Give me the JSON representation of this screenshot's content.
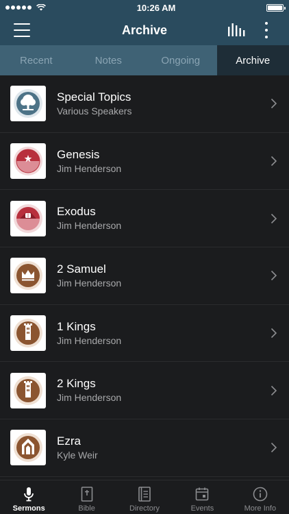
{
  "status_bar": {
    "time": "10:26 AM"
  },
  "nav": {
    "title": "Archive"
  },
  "tabs": [
    {
      "label": "Recent"
    },
    {
      "label": "Notes"
    },
    {
      "label": "Ongoing"
    },
    {
      "label": "Archive"
    }
  ],
  "series": [
    {
      "title": "Special Topics",
      "speaker": "Various Speakers",
      "icon": "tree-icon",
      "color": "#4d7387"
    },
    {
      "title": "Genesis",
      "speaker": "Jim Henderson",
      "icon": "star-icon",
      "color": "#b8303d"
    },
    {
      "title": "Exodus",
      "speaker": "Jim Henderson",
      "icon": "mountain-tablet-icon",
      "color": "#b8303d"
    },
    {
      "title": "2 Samuel",
      "speaker": "Jim Henderson",
      "icon": "crown-icon",
      "color": "#8b5530"
    },
    {
      "title": "1 Kings",
      "speaker": "Jim Henderson",
      "icon": "tower-icon",
      "color": "#8b5530"
    },
    {
      "title": "2 Kings",
      "speaker": "Jim Henderson",
      "icon": "tower-icon",
      "color": "#8b5530"
    },
    {
      "title": "Ezra",
      "speaker": "Kyle Weir",
      "icon": "arch-icon",
      "color": "#8b5530"
    }
  ],
  "tab_bar": [
    {
      "label": "Sermons",
      "icon": "microphone-icon"
    },
    {
      "label": "Bible",
      "icon": "bible-icon"
    },
    {
      "label": "Directory",
      "icon": "directory-icon"
    },
    {
      "label": "Events",
      "icon": "calendar-icon"
    },
    {
      "label": "More Info",
      "icon": "info-icon"
    }
  ]
}
